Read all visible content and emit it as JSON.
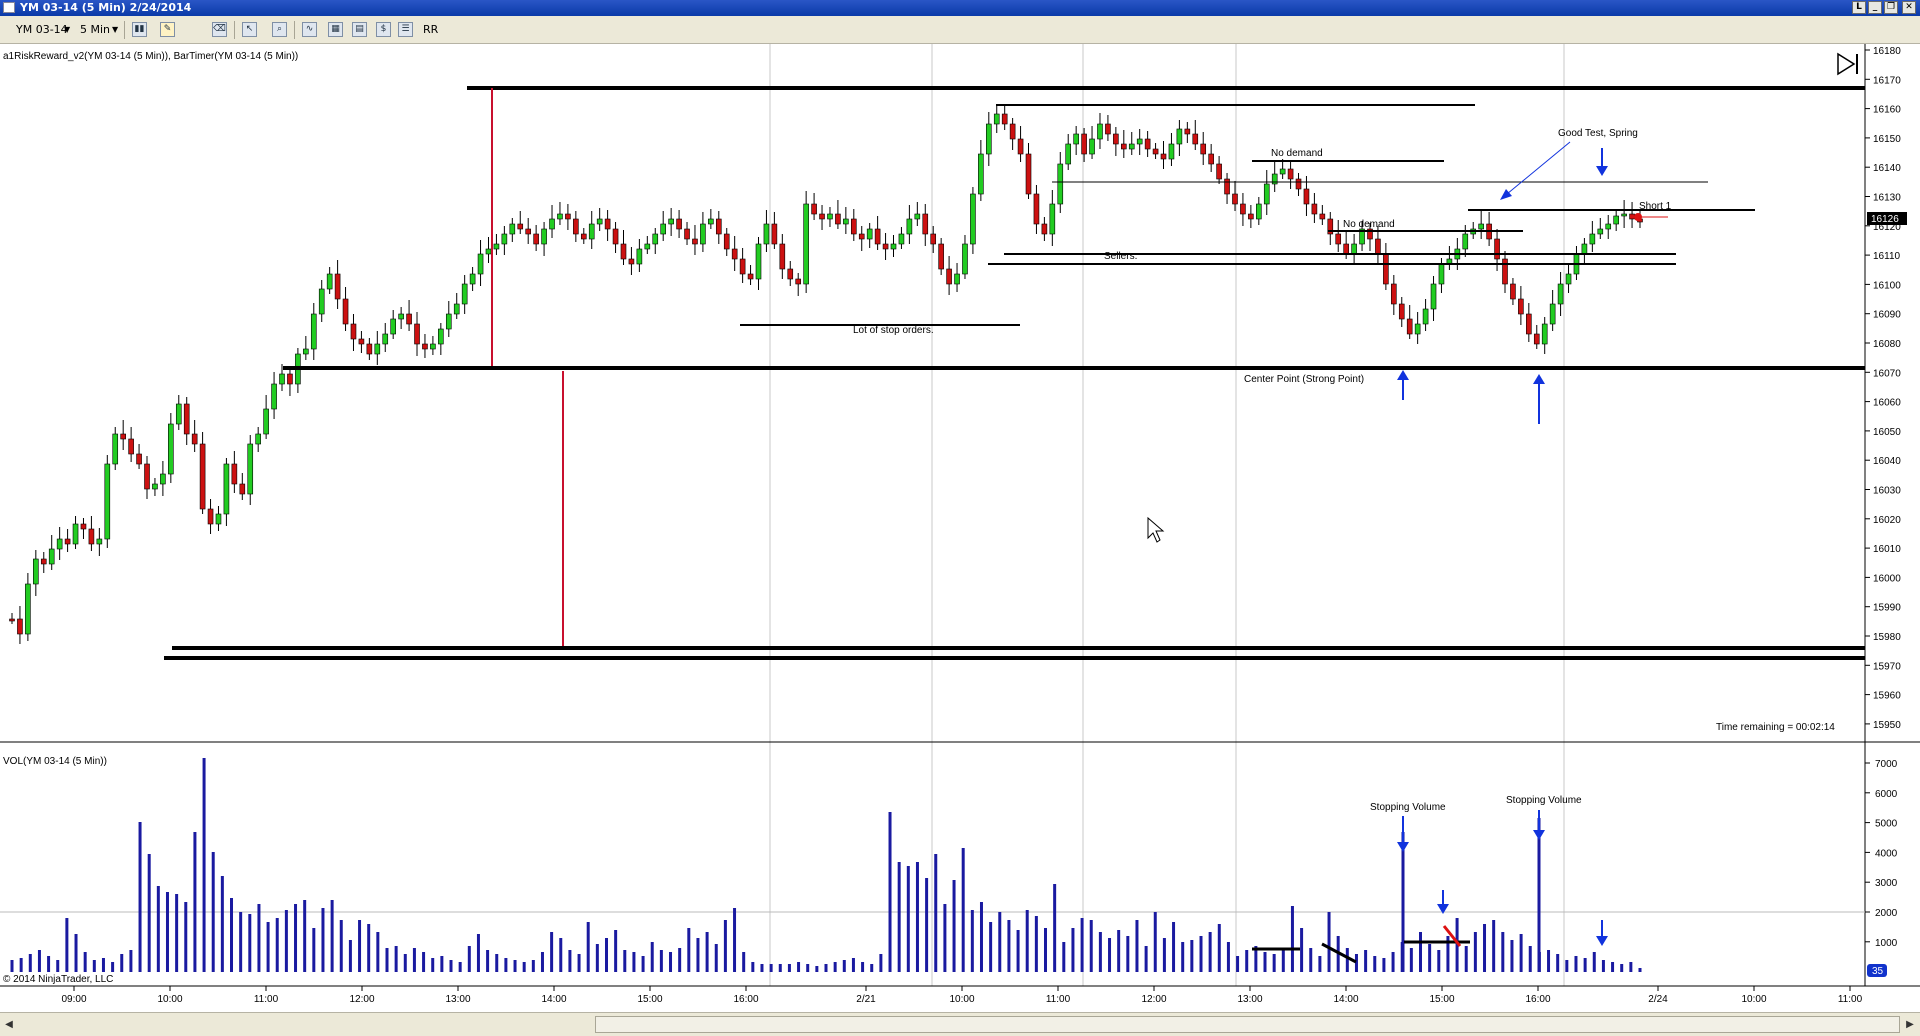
{
  "window": {
    "title": "YM 03-14 (5 Min)  2/24/2014",
    "buttons": [
      "L",
      "_",
      "❐",
      "✕"
    ]
  },
  "toolbar": {
    "instrument": "YM 03-14",
    "interval": "5 Min",
    "rr_label": "RR",
    "icons": [
      "bar-style-icon",
      "pencil-draw-icon",
      "eraser-icon",
      "cursor-icon",
      "zoom-icon",
      "indicators-icon",
      "strategies-icon",
      "chart-trader-icon",
      "data-box-icon",
      "properties-icon"
    ]
  },
  "price_panel": {
    "indicator_label": "a1RiskReward_v2(YM 03-14 (5 Min)), BarTimer(YM 03-14 (5 Min))",
    "time_remaining": "Time remaining = 00:02:14",
    "current_price": "16126",
    "y_ticks": [
      "16180",
      "16170",
      "16160",
      "16150",
      "16140",
      "16130",
      "16120",
      "16110",
      "16100",
      "16090",
      "16080",
      "16070",
      "16060",
      "16050",
      "16040",
      "16030",
      "16020",
      "16010",
      "16000",
      "15990",
      "15980",
      "15970",
      "15960",
      "15950"
    ],
    "annotations": {
      "lot_of_stop_orders": "Lot of stop orders.",
      "no_demand_1": "No demand",
      "no_demand_2": "No demand",
      "sellers": "Sellers.",
      "good_test_spring": "Good Test, Spring",
      "short_1": "Short 1",
      "center_point": "Center Point (Strong Point)"
    }
  },
  "volume_panel": {
    "label": "VOL(YM 03-14 (5 Min))",
    "current_volume": "35",
    "y_ticks": [
      "7000",
      "6000",
      "5000",
      "4000",
      "3000",
      "2000",
      "1000"
    ],
    "annotations": {
      "stopping_volume_1": "Stopping Volume",
      "stopping_volume_2": "Stopping Volume"
    }
  },
  "x_axis": {
    "ticks": [
      "09:00",
      "10:00",
      "11:00",
      "12:00",
      "13:00",
      "14:00",
      "15:00",
      "16:00",
      "2/21",
      "10:00",
      "11:00",
      "12:00",
      "13:00",
      "14:00",
      "15:00",
      "16:00",
      "2/24",
      "10:00",
      "11:00"
    ]
  },
  "copyright": "© 2014 NinjaTrader, LLC",
  "colors": {
    "up_candle": "#22cc22",
    "down_candle": "#cc1111",
    "volume": "#1a1aa0",
    "arrow": "#1133dd",
    "red_line": "#c8102e"
  }
}
